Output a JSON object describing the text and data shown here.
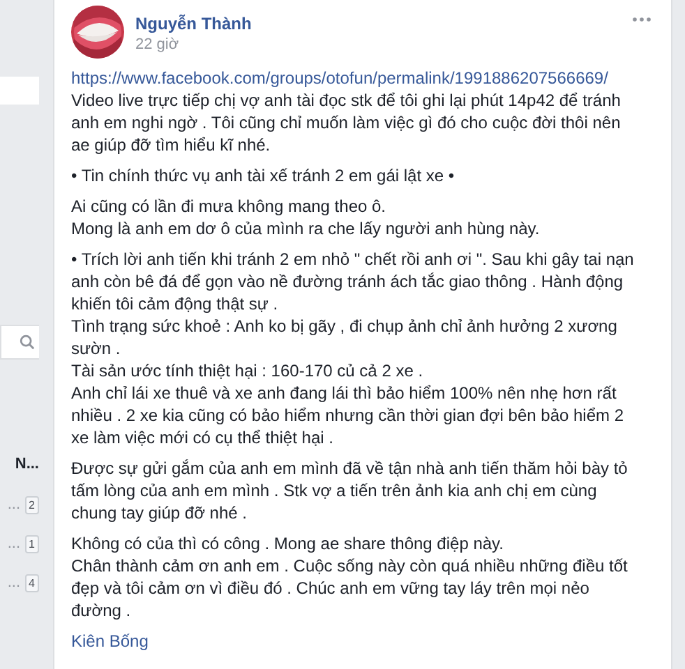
{
  "sidebar": {
    "search_field": {
      "kind": "search"
    },
    "group_title": "N...",
    "items": [
      {
        "label": "...",
        "count": "2"
      },
      {
        "label": "...",
        "count": "1"
      },
      {
        "label": "...",
        "count": "4"
      }
    ]
  },
  "post": {
    "author": "Nguyễn Thành",
    "time": "22 giờ",
    "link": "https://www.facebook.com/groups/otofun/permalink/1991886207566669/",
    "paragraphs": [
      {
        "lines": [
          "Video live trực tiếp chị vợ anh tài đọc stk để tôi ghi lại phút 14p42 để tránh",
          "anh em nghi ngờ . Tôi cũng chỉ muốn làm việc gì đó cho cuộc đời thôi nên",
          "ae giúp đỡ tìm hiểu kĩ nhé."
        ]
      },
      {
        "lines": [
          "• Tin chính thức vụ anh tài xế tránh 2 em gái lật xe •"
        ]
      },
      {
        "lines": [
          "Ai cũng có lần đi mưa không mang theo ô.",
          "Mong là anh em dơ ô của mình ra che lấy người anh hùng này."
        ]
      },
      {
        "lines": [
          "• Trích lời anh tiến khi tránh 2 em nhỏ \" chết rồi anh ơi \". Sau khi gây tai nạn",
          "anh còn bê đá để gọn vào nề đường tránh ách tắc giao thông . Hành động",
          "khiến tôi cảm động thật sự .",
          "Tình trạng sức khoẻ : Anh ko bị gãy , đi chụp ảnh chỉ ảnh hưởng 2 xương",
          "sườn .",
          "Tài sản ước tính thiệt hại : 160-170 củ cả 2 xe .",
          "Anh chỉ lái xe thuê và xe anh đang lái thì bảo hiểm 100% nên nhẹ hơn rất",
          "nhiều . 2 xe kia cũng có bảo hiểm nhưng cần thời gian đợi bên bảo hiểm 2",
          "xe làm việc mới có cụ thể thiệt hại ."
        ]
      },
      {
        "lines": [
          "Được sự gửi gắm của anh em mình đã về tận nhà anh tiến thăm hỏi bày tỏ",
          "tấm lòng của anh em mình . Stk vợ a tiến trên ảnh kia anh chị em cùng",
          "chung tay giúp đỡ nhé ."
        ]
      },
      {
        "lines": [
          "Không có của thì có công . Mong ae share thông điệp này.",
          "Chân thành cảm ơn anh em . Cuộc sống này còn quá nhiều những điều tốt",
          "đẹp và tôi cảm ơn vì điều đó . Chúc anh em vững tay láy trên mọi nẻo",
          "đường ."
        ]
      }
    ],
    "tag": "Kiên Bống"
  }
}
